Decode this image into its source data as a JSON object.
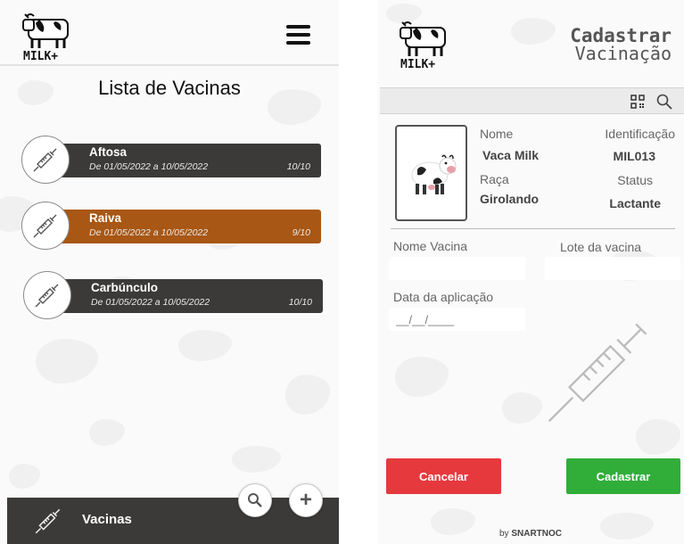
{
  "left": {
    "logo_text": "MILK+",
    "menu_icon": "hamburger-menu-icon",
    "title": "Lista de Vacinas",
    "vaccines": [
      {
        "name": "Aftosa",
        "period": "De 01/05/2022  a 10/05/2022",
        "count": "10/10",
        "color": "#3c3a38"
      },
      {
        "name": "Raiva",
        "period": "De 01/05/2022  a 10/05/2022",
        "count": "9/10",
        "color": "#a85714"
      },
      {
        "name": "Carbúnculo",
        "period": "De 01/05/2022  a 10/05/2022",
        "count": "10/10",
        "color": "#3c3a38"
      }
    ],
    "fab_search_icon": "search-icon",
    "fab_add_label": "+",
    "bottom_nav_label": "Vacinas"
  },
  "right": {
    "logo_text": "MILK+",
    "title_line1": "Cadastrar",
    "title_line2": "Vacinação",
    "animal": {
      "name_label": "Nome",
      "name_value": "Vaca Milk",
      "id_label": "Identificação",
      "id_value": "MIL013",
      "breed_label": "Raça",
      "breed_value": "Girolando",
      "status_label": "Status",
      "status_value": "Lactante"
    },
    "vaccine_name_label": "Nome Vacina",
    "vaccine_name_value": "",
    "batch_label": "Lote da vacina",
    "batch_value": "",
    "date_label": "Data da aplicação",
    "date_placeholder": "__/__/____",
    "cancel_label": "Cancelar",
    "save_label": "Cadastrar",
    "footer_by": "by",
    "footer_brand": "SNARTNOC"
  },
  "colors": {
    "dark_bar": "#3c3a38",
    "orange_bar": "#a85714",
    "cancel": "#e5393e",
    "save": "#31ad3a"
  }
}
